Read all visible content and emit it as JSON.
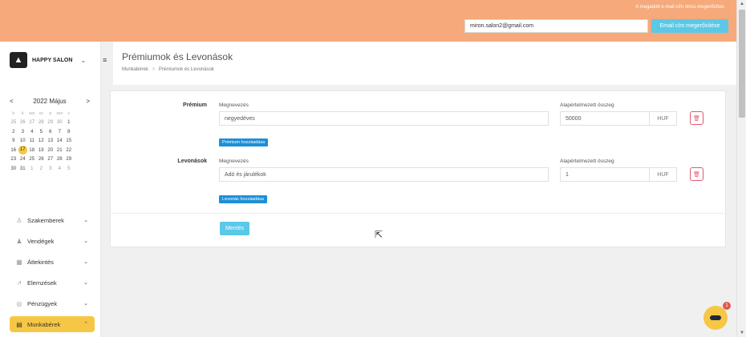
{
  "topbar": {
    "notice": "A megadott e-mail cím nincs megerősítve.",
    "email_value": "miron.salon2@gmail.com",
    "verify_button": "Email cím megerősítése"
  },
  "sidebar": {
    "salon_name": "HAPPY SALON",
    "calendar": {
      "prev": "<",
      "next": ">",
      "month_label": "2022 Május",
      "weekdays": [
        "h",
        "k",
        "sze",
        "cs",
        "p",
        "szo",
        "v"
      ],
      "weeks": [
        [
          "25",
          "26",
          "27",
          "28",
          "29",
          "30",
          "1"
        ],
        [
          "2",
          "3",
          "4",
          "5",
          "6",
          "7",
          "8"
        ],
        [
          "9",
          "10",
          "11",
          "12",
          "13",
          "14",
          "15"
        ],
        [
          "16",
          "17",
          "18",
          "19",
          "20",
          "21",
          "22"
        ],
        [
          "23",
          "24",
          "25",
          "26",
          "27",
          "28",
          "29"
        ],
        [
          "30",
          "31",
          "1",
          "2",
          "3",
          "4",
          "5"
        ]
      ],
      "today": "17"
    },
    "menu": [
      {
        "label": "Szakemberek",
        "icon": "person-icon"
      },
      {
        "label": "Vendégek",
        "icon": "users-icon"
      },
      {
        "label": "Áttekintés",
        "icon": "grid-icon"
      },
      {
        "label": "Elemzések",
        "icon": "chart-icon"
      },
      {
        "label": "Pénzügyek",
        "icon": "money-icon"
      },
      {
        "label": "Munkabérek",
        "icon": "payroll-icon",
        "active": true
      }
    ]
  },
  "header": {
    "title": "Prémiumok és Levonások",
    "breadcrumb_root": "Munkabérek",
    "breadcrumb_sep": ">",
    "breadcrumb_current": "Prémiumok és Levonások"
  },
  "premium": {
    "section_label": "Prémium",
    "name_label": "Megnevezés",
    "name_value": "negyedéves",
    "amount_label": "Alapértelmezett összeg",
    "amount_value": "50000",
    "currency": "HUF",
    "add_button": "Prémium hozzáadása"
  },
  "deduction": {
    "section_label": "Levonások",
    "name_label": "Megnevezés",
    "name_value": "Adó és járulékok",
    "amount_label": "Alapértelmezett összeg",
    "amount_value": "1",
    "currency": "HUF",
    "add_button": "Levonás hozzáadása"
  },
  "save_button": "Mentés",
  "chat": {
    "badge": "1"
  },
  "colors": {
    "topbar": "#f6a97a",
    "accent_yellow": "#f6c744",
    "primary_blue": "#1d8fd6",
    "light_blue": "#5bc8e8",
    "danger": "#e05a6e"
  }
}
